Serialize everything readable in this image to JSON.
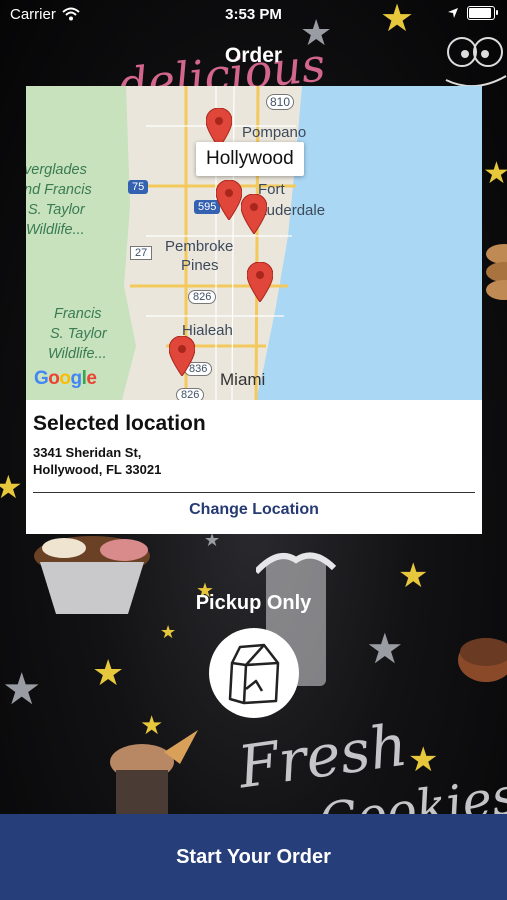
{
  "status": {
    "carrier": "Carrier",
    "time": "3:53 PM",
    "battery_level": 1.0
  },
  "header": {
    "title": "Order"
  },
  "map": {
    "callout": "Hollywood",
    "labels": {
      "pompano": "Pompano",
      "fort": "Fort",
      "lauderdale": "Lauderdale",
      "pembroke": "Pembroke",
      "pines": "Pines",
      "hialeah": "Hialeah",
      "miami": "Miami",
      "everglades1": "verglades",
      "everglades2": "nd Francis",
      "everglades3": "S. Taylor",
      "everglades4": "Wildlife...",
      "francis1": "Francis",
      "francis2": "S. Taylor",
      "francis3": "Wildlife...",
      "hwy810": "810",
      "hwy75": "75",
      "hwy595": "595",
      "hwy27": "27",
      "hwy826a": "826",
      "hwy836": "836",
      "hwy826b": "826"
    },
    "google_logo": "Google"
  },
  "selected": {
    "title": "Selected location",
    "address_line1": "3341 Sheridan St,",
    "address_line2": "Hollywood, FL 33021",
    "change_label": "Change Location"
  },
  "pickup": {
    "label": "Pickup Only",
    "icon": "bag-icon"
  },
  "footer": {
    "start_label": "Start Your Order"
  },
  "background": {
    "text1": "delicious",
    "text2": "Fresh",
    "text3": "Cookies"
  },
  "colors": {
    "primary": "#263e7a",
    "link": "#263a73",
    "star": "#e7c73b",
    "pin": "#e0463a"
  }
}
